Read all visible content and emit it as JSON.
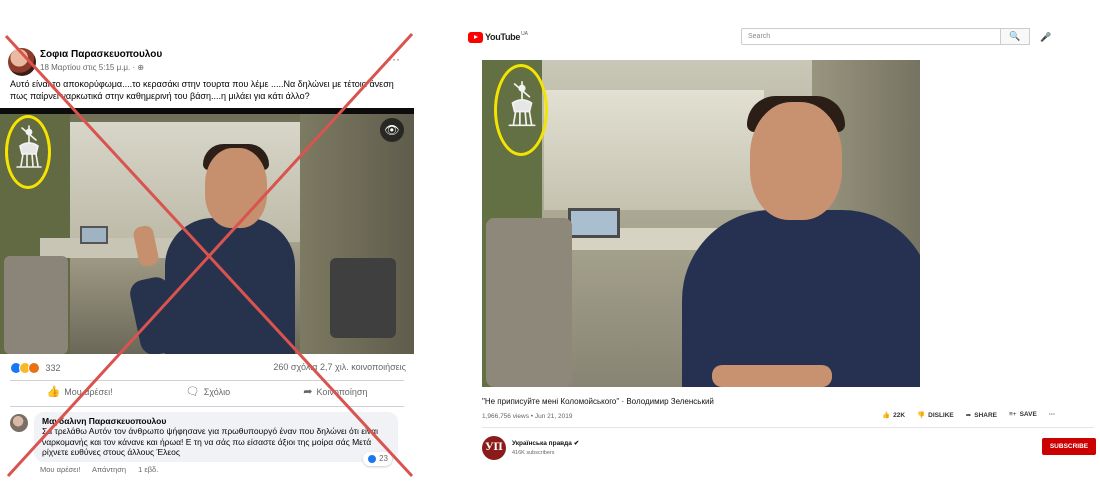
{
  "facebook": {
    "author": "Σοφια Παρασκευοπουλου",
    "meta": "18 Μαρτίου στις 5:15 μ.μ. · ⊕",
    "more_icon": "ellipsis-icon",
    "post_text": "Αυτό είναι το αποκορύφωμα....το κερασάκι στην τουρτα που λέμε .....Να δηλώνει με τέτοια άνεση πως παίρνει ναρκωτικά στην καθημερινή του βάση....η μιλάει για κάτι άλλο?",
    "eye_icon": "👁",
    "reaction_count": "332",
    "comments_shares": "260 σχόλια 2,7 χιλ. κοινοποιήσεις",
    "actions": {
      "like": "Μου αρέσει!",
      "like_icon": "👍",
      "comment": "Σχόλιο",
      "comment_icon": "🗨",
      "share": "Κοινοποίηση",
      "share_icon": "➦"
    },
    "comment": {
      "author": "Μαγδαλινη Παρασκευοπουλου",
      "text": "Σα τρελάθω Αυτόν τον άνθρωπο ψήφησανε για πρωθυπουργό έναν που δηλώνει ότι είναι ναρκομανής και τον κάνανε και ήρωα! Ε τη να σάς πω είσαστε άξιοι της μοίρα σάς Μετά ρίχνετε ευθύνες στους άλλους Έλεος",
      "reactions": "23",
      "footer_like": "Μου αρέσει!",
      "footer_reply": "Απάντηση",
      "footer_time": "1 εβδ."
    },
    "colors": {
      "cross": "#d9534f",
      "highlight_ring": "#f5e400",
      "like_blue": "#1877f2"
    }
  },
  "youtube": {
    "logo_text": "YouTube",
    "logo_tm": "UA",
    "search_placeholder": "Search",
    "search_icon": "🔍",
    "mic_icon": "🎤",
    "video_title": "\"Не приписуйте мені Коломойського\" · Володимир Зеленський",
    "views_date": "1,966,756 views • Jun 21, 2019",
    "actions": {
      "like": "22K",
      "like_icon": "👍",
      "dislike": "DISLIKE",
      "dislike_icon": "👎",
      "share": "SHARE",
      "share_icon": "➦",
      "save": "SAVE",
      "save_icon": "≡+",
      "more": "···"
    },
    "channel": {
      "avatar_text": "УП",
      "name": "Українська правда ✔",
      "subscribers": "416K subscribers",
      "subscribe": "SUBSCRIBE"
    },
    "colors": {
      "subscribe_bg": "#cc0000",
      "logo_red": "#ff0000",
      "highlight_ring": "#f5e400"
    }
  }
}
